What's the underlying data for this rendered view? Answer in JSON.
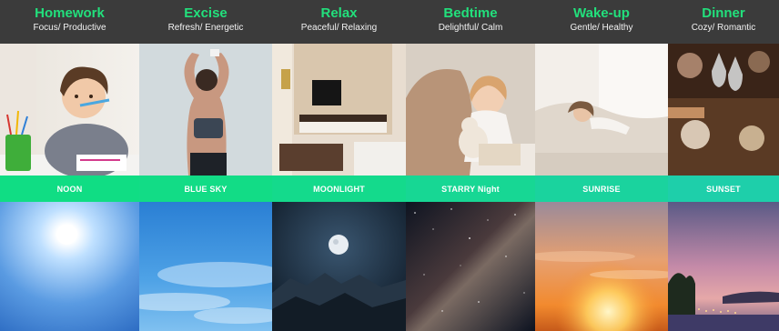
{
  "accent_color": "#22e07c",
  "header_color": "#3b3b3b",
  "modes": [
    {
      "title": "Homework",
      "subtitle": "Focus/ Productive",
      "sky": "NOON",
      "band_color": "#10dd84"
    },
    {
      "title": "Excise",
      "subtitle": "Refresh/ Energetic",
      "sky": "BLUE SKY",
      "band_color": "#12dc86"
    },
    {
      "title": "Relax",
      "subtitle": "Peaceful/ Relaxing",
      "sky": "MOONLIGHT",
      "band_color": "#14da8c"
    },
    {
      "title": "Bedtime",
      "subtitle": "Delightful/ Calm",
      "sky": "STARRY Night",
      "band_color": "#17d794"
    },
    {
      "title": "Wake-up",
      "subtitle": "Gentle/ Healthy",
      "sky": "SUNRISE",
      "band_color": "#1ad39e"
    },
    {
      "title": "Dinner",
      "subtitle": "Cozy/ Romantic",
      "sky": "SUNSET",
      "band_color": "#1ecfaa"
    }
  ]
}
